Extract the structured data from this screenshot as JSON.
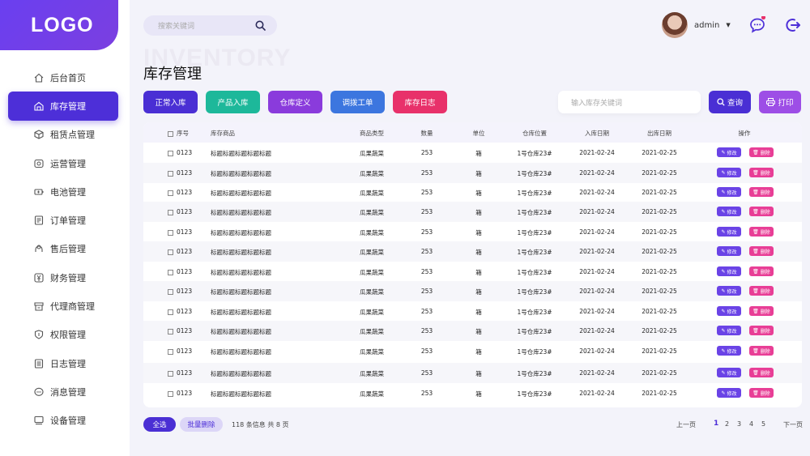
{
  "logo": "LOGO",
  "search": {
    "placeholder": "搜索关键词"
  },
  "user": {
    "name": "admin"
  },
  "sidebar": {
    "items": [
      {
        "label": "后台首页",
        "icon": "home-icon"
      },
      {
        "label": "库存管理",
        "icon": "inventory-icon",
        "active": true
      },
      {
        "label": "租赁点管理",
        "icon": "box-icon"
      },
      {
        "label": "运营管理",
        "icon": "operation-icon"
      },
      {
        "label": "电池管理",
        "icon": "battery-icon"
      },
      {
        "label": "订单管理",
        "icon": "order-icon"
      },
      {
        "label": "售后管理",
        "icon": "service-icon"
      },
      {
        "label": "财务管理",
        "icon": "finance-icon"
      },
      {
        "label": "代理商管理",
        "icon": "store-icon"
      },
      {
        "label": "权限管理",
        "icon": "shield-icon"
      },
      {
        "label": "日志管理",
        "icon": "log-icon"
      },
      {
        "label": "消息管理",
        "icon": "message-icon"
      },
      {
        "label": "设备管理",
        "icon": "device-icon"
      }
    ]
  },
  "page": {
    "watermark": "INVENTORY",
    "title": "库存管理"
  },
  "toolbar": {
    "buttons": [
      {
        "label": "正常入库",
        "color": "#4a2fd4"
      },
      {
        "label": "产品入库",
        "color": "#1db89a"
      },
      {
        "label": "仓库定义",
        "color": "#8a3bdc"
      },
      {
        "label": "调拨工单",
        "color": "#3c76df"
      },
      {
        "label": "库存日志",
        "color": "#e8316a"
      }
    ],
    "search_placeholder": "输入库存关键词",
    "query_label": "查询",
    "print_label": "打印"
  },
  "table": {
    "headers": [
      "序号",
      "库存商品",
      "商品类型",
      "数量",
      "单位",
      "仓库位置",
      "入库日期",
      "出库日期",
      "操作"
    ],
    "rows": [
      [
        "0123",
        "标题标题标题标题标题",
        "瓜果蔬菜",
        "253",
        "箱",
        "1号仓库23#",
        "2021-02-24",
        "2021-02-25"
      ],
      [
        "0123",
        "标题标题标题标题标题",
        "瓜果蔬菜",
        "253",
        "箱",
        "1号仓库23#",
        "2021-02-24",
        "2021-02-25"
      ],
      [
        "0123",
        "标题标题标题标题标题",
        "瓜果蔬菜",
        "253",
        "箱",
        "1号仓库23#",
        "2021-02-24",
        "2021-02-25"
      ],
      [
        "0123",
        "标题标题标题标题标题",
        "瓜果蔬菜",
        "253",
        "箱",
        "1号仓库23#",
        "2021-02-24",
        "2021-02-25"
      ],
      [
        "0123",
        "标题标题标题标题标题",
        "瓜果蔬菜",
        "253",
        "箱",
        "1号仓库23#",
        "2021-02-24",
        "2021-02-25"
      ],
      [
        "0123",
        "标题标题标题标题标题",
        "瓜果蔬菜",
        "253",
        "箱",
        "1号仓库23#",
        "2021-02-24",
        "2021-02-25"
      ],
      [
        "0123",
        "标题标题标题标题标题",
        "瓜果蔬菜",
        "253",
        "箱",
        "1号仓库23#",
        "2021-02-24",
        "2021-02-25"
      ],
      [
        "0123",
        "标题标题标题标题标题",
        "瓜果蔬菜",
        "253",
        "箱",
        "1号仓库23#",
        "2021-02-24",
        "2021-02-25"
      ],
      [
        "0123",
        "标题标题标题标题标题",
        "瓜果蔬菜",
        "253",
        "箱",
        "1号仓库23#",
        "2021-02-24",
        "2021-02-25"
      ],
      [
        "0123",
        "标题标题标题标题标题",
        "瓜果蔬菜",
        "253",
        "箱",
        "1号仓库23#",
        "2021-02-24",
        "2021-02-25"
      ],
      [
        "0123",
        "标题标题标题标题标题",
        "瓜果蔬菜",
        "253",
        "箱",
        "1号仓库23#",
        "2021-02-24",
        "2021-02-25"
      ],
      [
        "0123",
        "标题标题标题标题标题",
        "瓜果蔬菜",
        "253",
        "箱",
        "1号仓库23#",
        "2021-02-24",
        "2021-02-25"
      ],
      [
        "0123",
        "标题标题标题标题标题",
        "瓜果蔬菜",
        "253",
        "箱",
        "1号仓库23#",
        "2021-02-24",
        "2021-02-25"
      ]
    ],
    "edit_label": "修改",
    "delete_label": "删除"
  },
  "footer": {
    "select_all": "全选",
    "batch_delete": "批量删除",
    "info": "118 条信息 共 8 页",
    "prev": "上一页",
    "next": "下一页",
    "pages": [
      "1",
      "2",
      "3",
      "4",
      "5"
    ],
    "current_page": "1"
  },
  "colors": {
    "accent": "#4d2fd8",
    "notification_dot": "#e8316a",
    "delete": "#e83e96",
    "edit": "#6a43e6"
  }
}
